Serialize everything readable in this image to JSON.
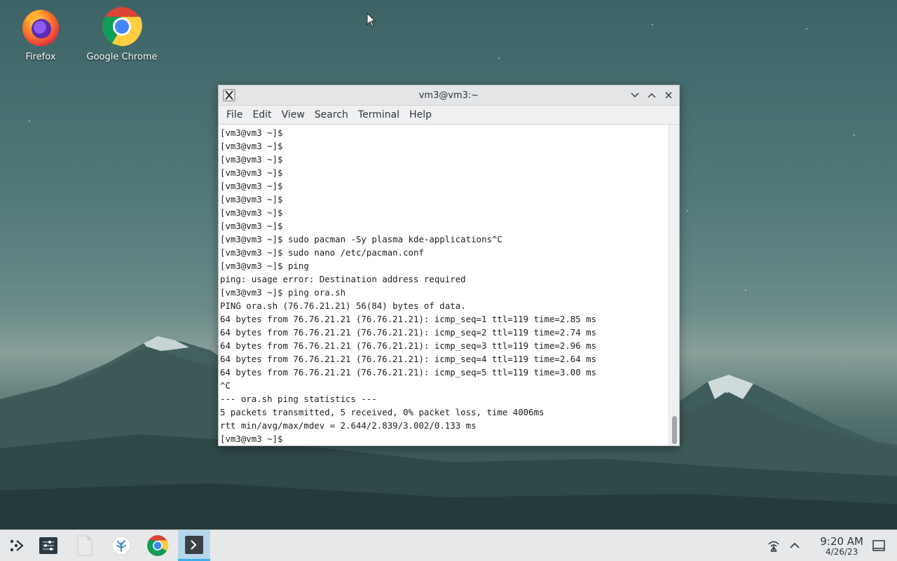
{
  "desktop": {
    "icons": [
      {
        "label": "Firefox",
        "icon": "firefox-icon"
      },
      {
        "label": "Google Chrome",
        "icon": "chrome-icon"
      }
    ]
  },
  "window": {
    "title": "vm3@vm3:~",
    "menu": [
      "File",
      "Edit",
      "View",
      "Search",
      "Terminal",
      "Help"
    ],
    "controls": [
      "minimize-icon",
      "maximize-icon",
      "close-icon"
    ],
    "terminal_lines": [
      "[vm3@vm3 ~]$",
      "[vm3@vm3 ~]$",
      "[vm3@vm3 ~]$",
      "[vm3@vm3 ~]$",
      "[vm3@vm3 ~]$",
      "[vm3@vm3 ~]$",
      "[vm3@vm3 ~]$",
      "[vm3@vm3 ~]$",
      "[vm3@vm3 ~]$ sudo pacman -Sy plasma kde-applications^C",
      "[vm3@vm3 ~]$ sudo nano /etc/pacman.conf",
      "[vm3@vm3 ~]$ ping",
      "ping: usage error: Destination address required",
      "[vm3@vm3 ~]$ ping ora.sh",
      "PING ora.sh (76.76.21.21) 56(84) bytes of data.",
      "64 bytes from 76.76.21.21 (76.76.21.21): icmp_seq=1 ttl=119 time=2.85 ms",
      "64 bytes from 76.76.21.21 (76.76.21.21): icmp_seq=2 ttl=119 time=2.74 ms",
      "64 bytes from 76.76.21.21 (76.76.21.21): icmp_seq=3 ttl=119 time=2.96 ms",
      "64 bytes from 76.76.21.21 (76.76.21.21): icmp_seq=4 ttl=119 time=2.64 ms",
      "64 bytes from 76.76.21.21 (76.76.21.21): icmp_seq=5 ttl=119 time=3.00 ms",
      "^C",
      "--- ora.sh ping statistics ---",
      "5 packets transmitted, 5 received, 0% packet loss, time 4006ms",
      "rtt min/avg/max/mdev = 2.644/2.839/3.002/0.133 ms",
      "[vm3@vm3 ~]$"
    ]
  },
  "taskbar": {
    "items": [
      "app-launcher-icon",
      "system-settings-icon",
      "file-manager-icon",
      "discover-icon",
      "chrome-icon",
      "terminal-icon"
    ],
    "tray": [
      "network-icon",
      "expand-tray-icon"
    ],
    "time": "9:20 AM",
    "date": "4/26/23",
    "show_desktop": "show-desktop-icon"
  },
  "colors": {
    "accent": "#3daee9",
    "window_bg": "#eff0f1",
    "terminal_bg": "#ffffff"
  }
}
